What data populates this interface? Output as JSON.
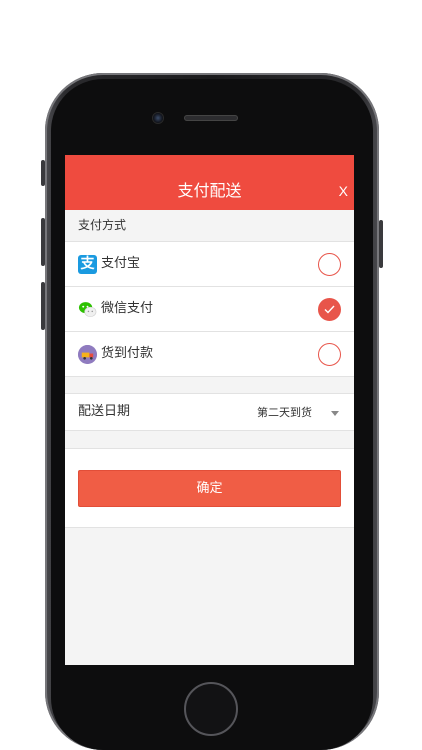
{
  "header": {
    "title": "支付配送",
    "close_label": "X"
  },
  "payment": {
    "section_label": "支付方式",
    "options": [
      {
        "label": "支付宝",
        "icon": "alipay-icon",
        "icon_glyph": "支",
        "selected": false
      },
      {
        "label": "微信支付",
        "icon": "wechat-icon",
        "selected": true
      },
      {
        "label": "货到付款",
        "icon": "cash-on-delivery-icon",
        "selected": false
      }
    ]
  },
  "delivery": {
    "label": "配送日期",
    "value": "第二天到货"
  },
  "confirm": {
    "label": "确定"
  },
  "colors": {
    "accent": "#ef4b3f",
    "button": "#f05d45",
    "radio": "#e8554a",
    "alipay": "#1a9ae0",
    "wechat": "#2dc100"
  }
}
